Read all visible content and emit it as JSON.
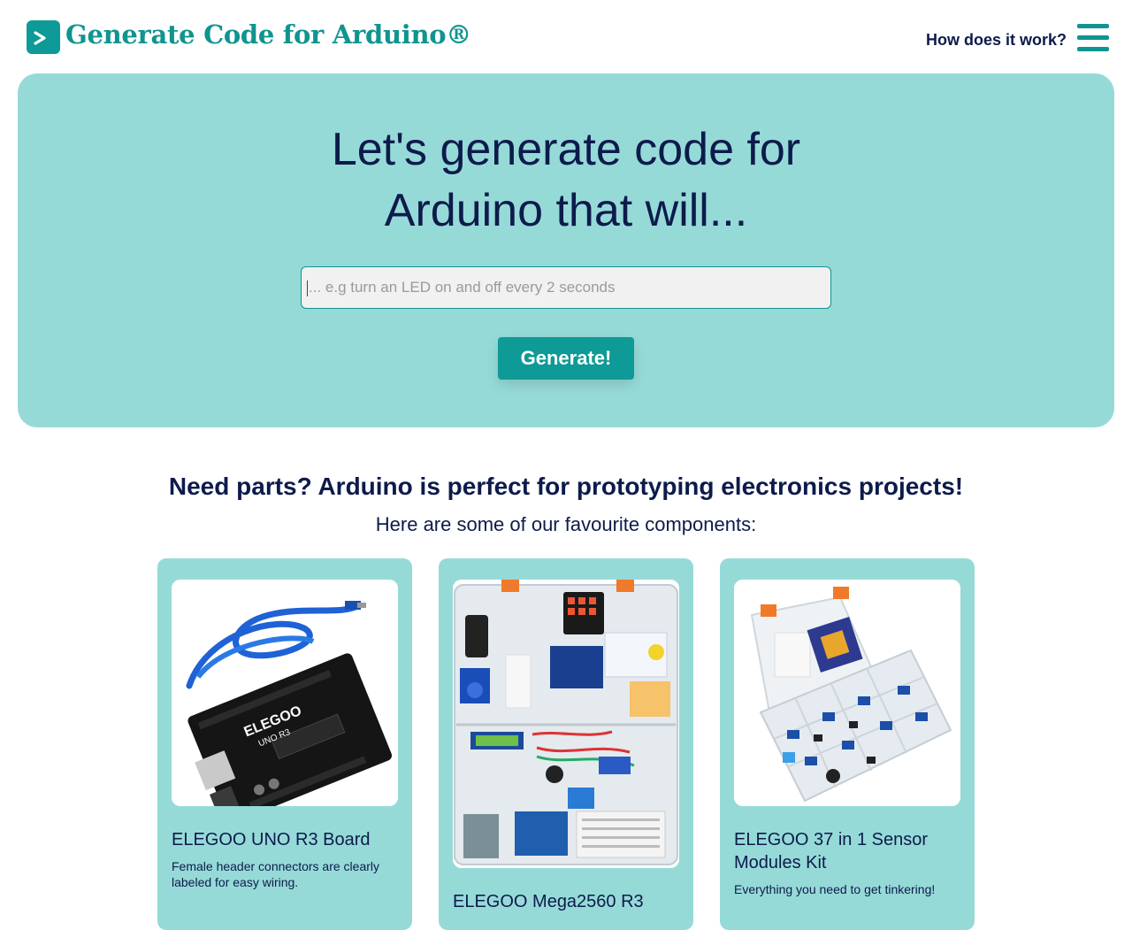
{
  "header": {
    "app_title": "Generate Code for Arduino®",
    "logo_glyph": ">",
    "how_link": "How does it work?",
    "menu_icon": "hamburger-menu-icon",
    "brand_color": "#10948f"
  },
  "hero": {
    "title_line1": "Let's generate code for",
    "title_line2": "Arduino that will...",
    "input_value": "",
    "input_placeholder": "... e.g turn an LED on and off every 2 seconds",
    "generate_label": "Generate!",
    "background_color": "#96dad8"
  },
  "parts": {
    "heading": "Need parts? Arduino is perfect for prototyping electronics projects!",
    "subheading": "Here are some of our favourite components:",
    "cards": [
      {
        "title": "ELEGOO UNO R3 Board",
        "description": "Female header connectors are clearly labeled for easy wiring.",
        "image": "arduino-uno-board-photo"
      },
      {
        "title": "ELEGOO Mega2560 R3",
        "description": "",
        "image": "mega2560-starter-kit-photo"
      },
      {
        "title": "ELEGOO 37 in 1 Sensor Modules Kit",
        "description": "Everything you need to get tinkering!",
        "image": "sensor-modules-kit-photo"
      }
    ]
  }
}
